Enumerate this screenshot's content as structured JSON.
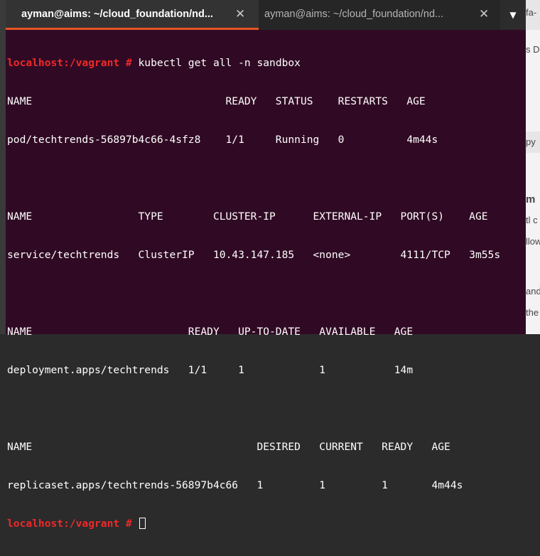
{
  "tabs": [
    {
      "title": "ayman@aims: ~/cloud_foundation/nd...",
      "close": "✕"
    },
    {
      "title": "ayman@aims: ~/cloud_foundation/nd...",
      "close": "✕"
    }
  ],
  "menu_glyph": "▼",
  "terminal": {
    "prompt": "localhost:/vagrant #",
    "command": " kubectl get all -n sandbox",
    "output": [
      "NAME                               READY   STATUS    RESTARTS   AGE",
      "pod/techtrends-56897b4c66-4sfz8    1/1     Running   0          4m44s",
      "",
      "NAME                 TYPE        CLUSTER-IP      EXTERNAL-IP   PORT(S)    AGE",
      "service/techtrends   ClusterIP   10.43.147.185   <none>        4111/TCP   3m55s",
      "",
      "NAME                         READY   UP-TO-DATE   AVAILABLE   AGE",
      "deployment.apps/techtrends   1/1     1            1           14m",
      "",
      "NAME                                    DESIRED   CURRENT   READY   AGE",
      "replicaset.apps/techtrends-56897b4c66   1         1         1       4m44s"
    ]
  },
  "background_fragments": [
    "fa-",
    "s D",
    "py",
    "m",
    "tl c",
    "llow",
    "and",
    "the"
  ]
}
